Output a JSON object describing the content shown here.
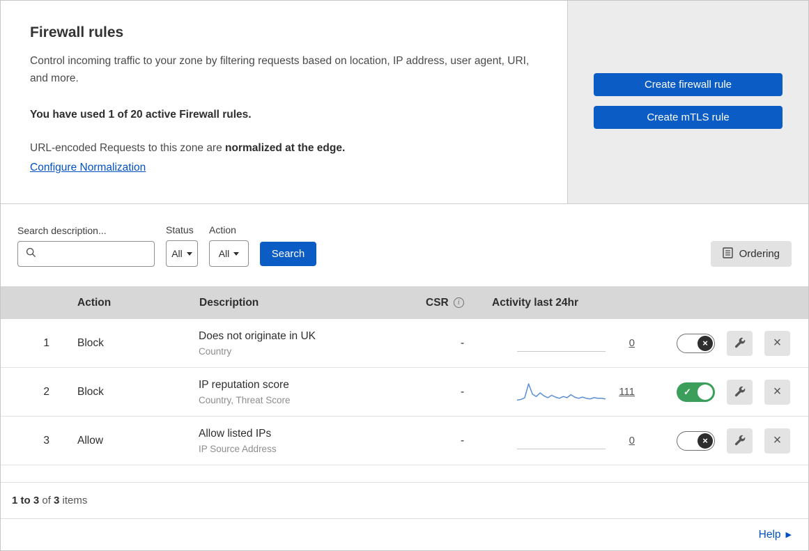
{
  "header": {
    "title": "Firewall rules",
    "description": "Control incoming traffic to your zone by filtering requests based on location, IP address, user agent, URI, and more.",
    "usage": "You have used 1 of 20 active Firewall rules.",
    "normalization_prefix": "URL-encoded Requests to this zone are ",
    "normalization_bold": "normalized at the edge.",
    "normalization_link": "Configure Normalization",
    "buttons": {
      "create_firewall": "Create firewall rule",
      "create_mtls": "Create mTLS rule"
    }
  },
  "filters": {
    "search_label": "Search description...",
    "status_label": "Status",
    "status_value": "All",
    "action_label": "Action",
    "action_value": "All",
    "search_button": "Search",
    "ordering_button": "Ordering"
  },
  "table": {
    "headers": {
      "action": "Action",
      "description": "Description",
      "csr": "CSR",
      "activity": "Activity last 24hr"
    },
    "rows": [
      {
        "index": "1",
        "action": "Block",
        "description": "Does not originate in UK",
        "fields": "Country",
        "csr": "-",
        "activity_count": "0",
        "enabled": false,
        "sparkline": []
      },
      {
        "index": "2",
        "action": "Block",
        "description": "IP reputation score",
        "fields": "Country, Threat Score",
        "csr": "-",
        "activity_count": "111",
        "enabled": true,
        "sparkline": [
          3,
          4,
          7,
          30,
          13,
          9,
          15,
          10,
          7,
          11,
          8,
          6,
          9,
          7,
          12,
          8,
          6,
          8,
          6,
          5,
          7,
          6,
          6,
          5
        ]
      },
      {
        "index": "3",
        "action": "Allow",
        "description": "Allow listed IPs",
        "fields": "IP Source Address",
        "csr": "-",
        "activity_count": "0",
        "enabled": false,
        "sparkline": []
      }
    ],
    "footer": {
      "range_bold": "1 to 3",
      "of_text": " of ",
      "total_bold": "3",
      "items_text": " items"
    }
  },
  "help_link": "Help",
  "colors": {
    "primary_blue": "#0b5cc4",
    "toggle_green": "#3b9e5a",
    "link_blue": "#0051c3",
    "sparkline_blue": "#5b8ed6"
  }
}
